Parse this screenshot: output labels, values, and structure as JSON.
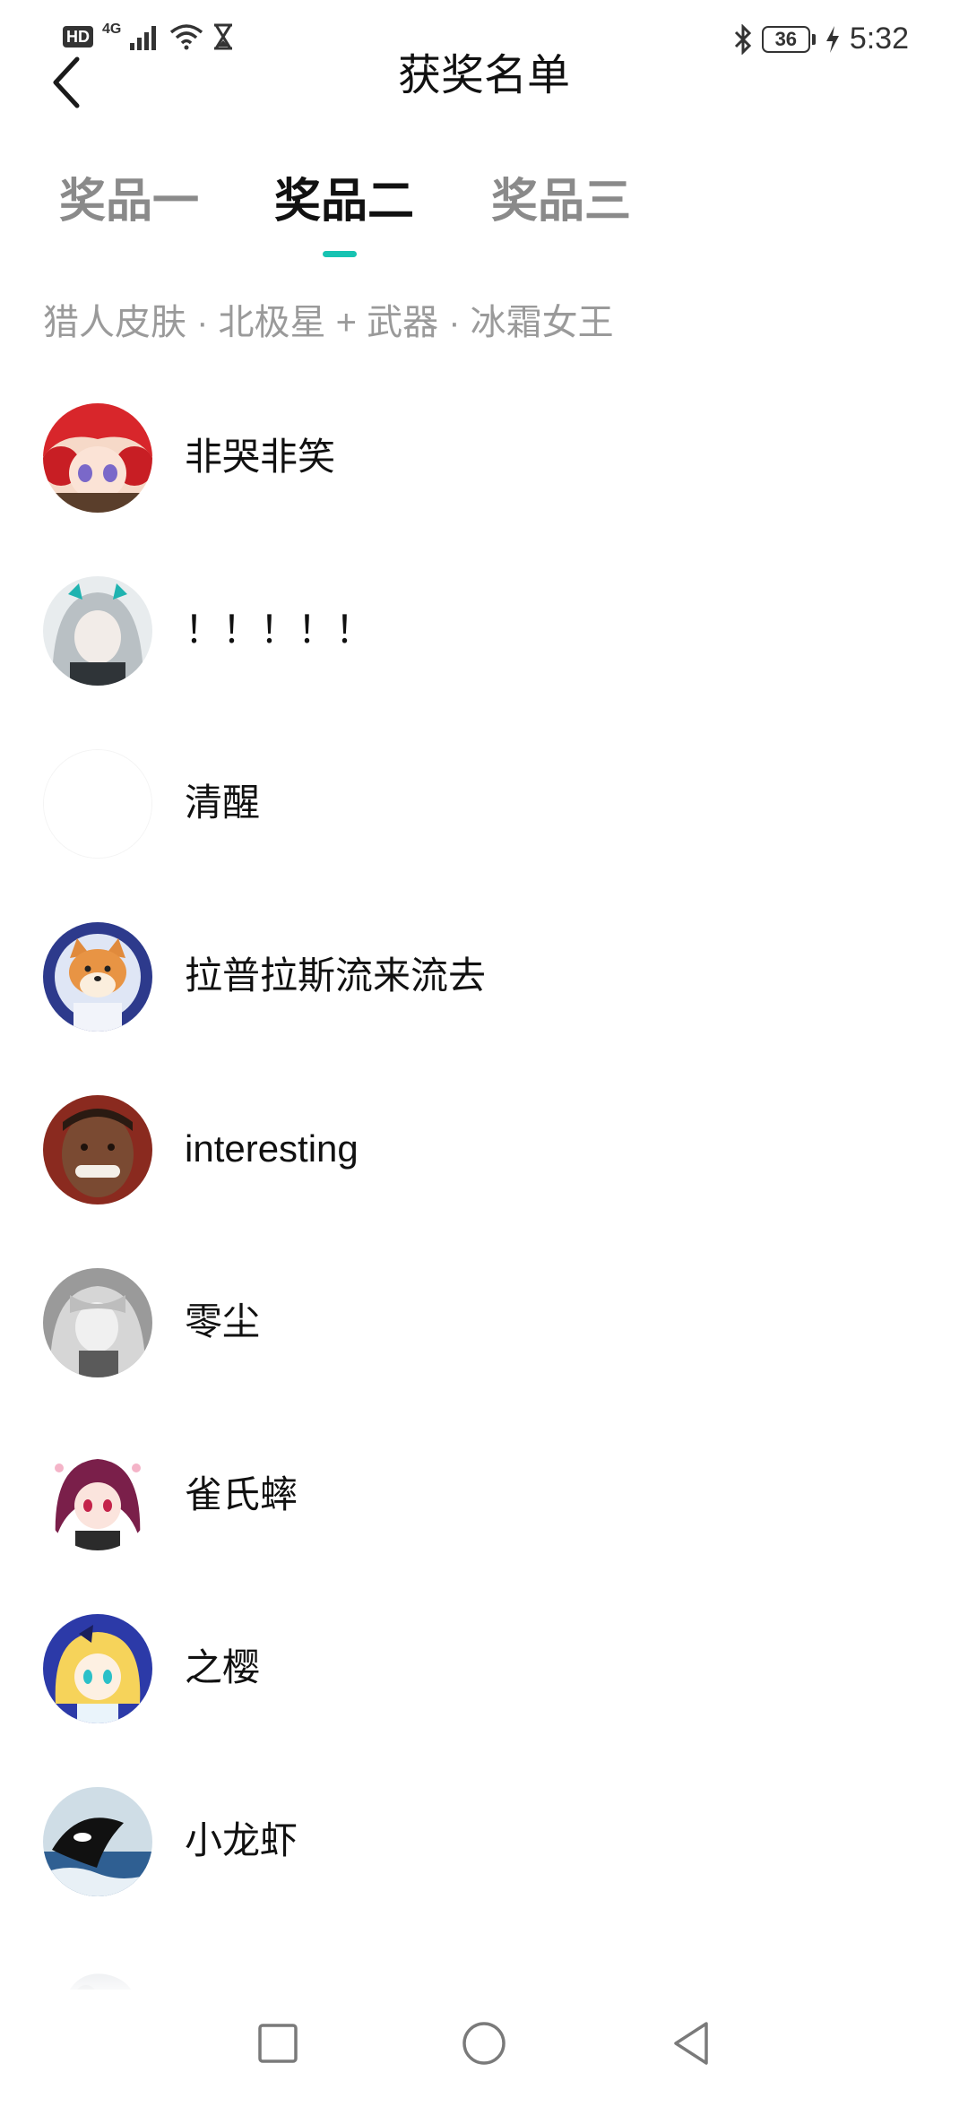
{
  "status_bar": {
    "hd": "HD",
    "network": "4G",
    "battery": "36",
    "time": "5:32"
  },
  "header": {
    "title": "获奖名单"
  },
  "tabs": [
    {
      "label": "奖品一",
      "active": false
    },
    {
      "label": "奖品二",
      "active": true
    },
    {
      "label": "奖品三",
      "active": false
    }
  ],
  "prize_description": "猎人皮肤 · 北极星 + 武器 · 冰霜女王",
  "winners": [
    {
      "name": "非哭非笑",
      "avatar": "red-hair-anime-avatar"
    },
    {
      "name": "！！！！！",
      "avatar": "silver-hair-anime-avatar"
    },
    {
      "name": "清醒",
      "avatar": "blank-avatar"
    },
    {
      "name": "拉普拉斯流来流去",
      "avatar": "shiba-dog-avatar"
    },
    {
      "name": "interesting",
      "avatar": "smiling-man-avatar"
    },
    {
      "name": "零尘",
      "avatar": "grayscale-anime-avatar"
    },
    {
      "name": "雀氏蟀",
      "avatar": "purple-hair-anime-avatar"
    },
    {
      "name": "之樱",
      "avatar": "blonde-anime-avatar"
    },
    {
      "name": "小龙虾",
      "avatar": "orca-avatar"
    },
    {
      "name": "",
      "avatar": "partial-avatar"
    }
  ],
  "colors": {
    "accent": "#17c3b2",
    "text_primary": "#111111",
    "text_secondary": "#9a9a9a"
  },
  "nav_icons": [
    "recent-apps-icon",
    "home-icon",
    "back-nav-icon"
  ]
}
